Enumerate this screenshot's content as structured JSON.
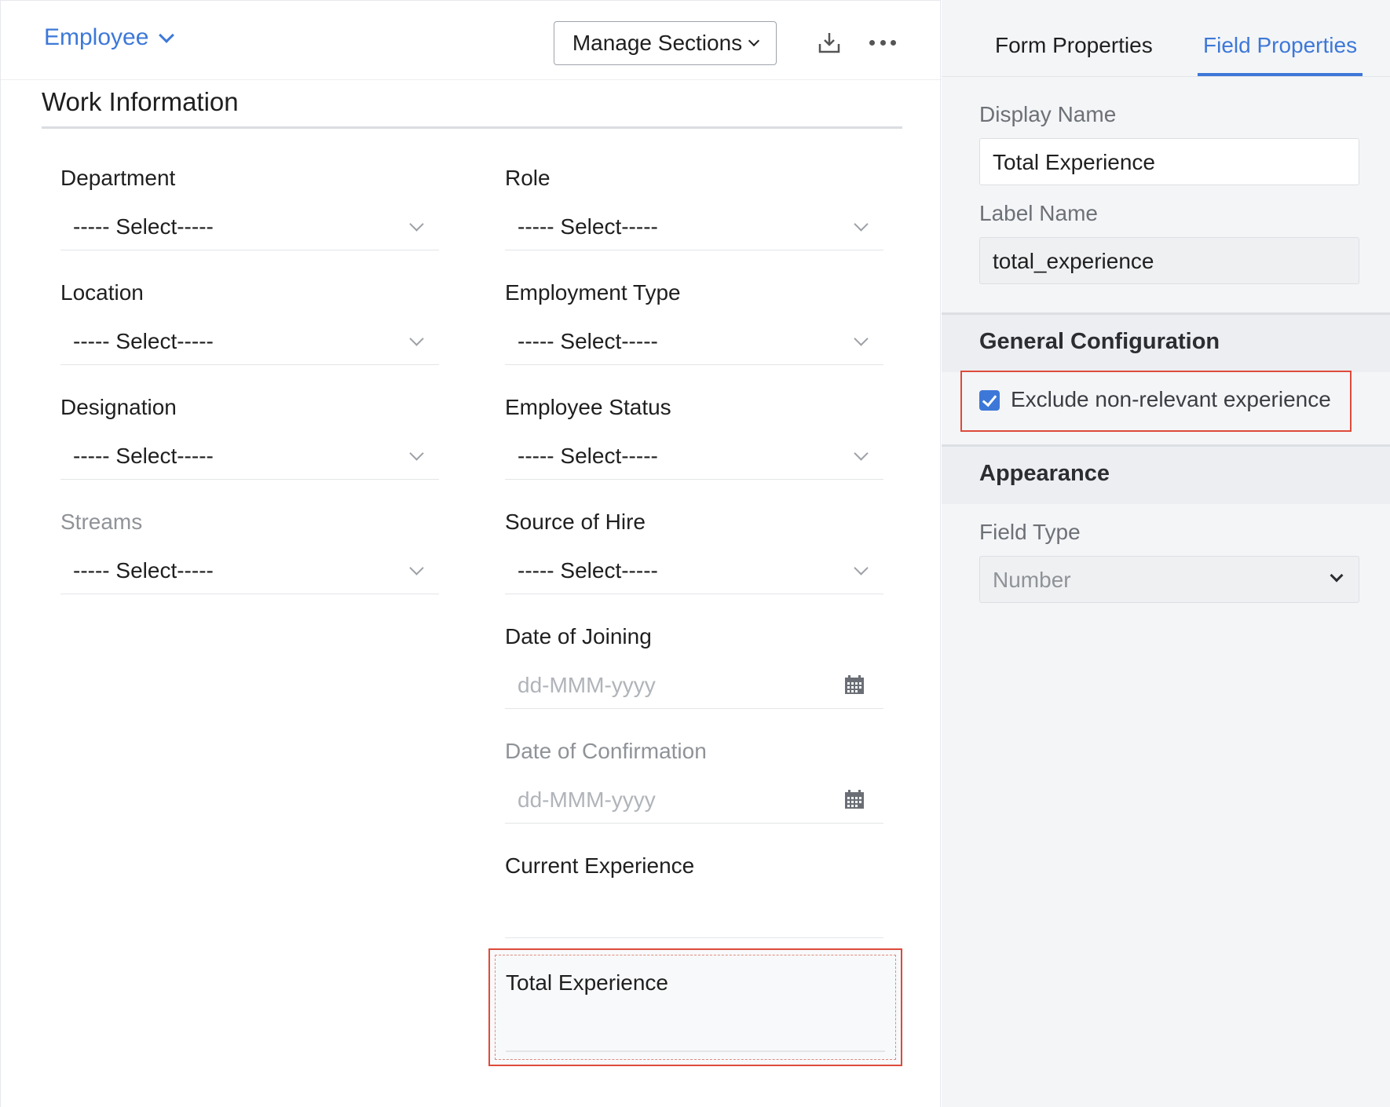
{
  "header": {
    "module_label": "Employee",
    "manage_sections_label": "Manage Sections",
    "download_icon": "download-icon",
    "more_icon": "more-horizontal-icon"
  },
  "section": {
    "title": "Work Information"
  },
  "fields": {
    "department": {
      "label": "Department",
      "value": "----- Select-----"
    },
    "role": {
      "label": "Role",
      "value": "----- Select-----"
    },
    "location": {
      "label": "Location",
      "value": "----- Select-----"
    },
    "employment_type": {
      "label": "Employment Type",
      "value": "----- Select-----"
    },
    "designation": {
      "label": "Designation",
      "value": "----- Select-----"
    },
    "employee_status": {
      "label": "Employee Status",
      "value": "----- Select-----"
    },
    "streams": {
      "label": "Streams",
      "value": "----- Select-----"
    },
    "source_of_hire": {
      "label": "Source of Hire",
      "value": "----- Select-----"
    },
    "date_of_joining": {
      "label": "Date of Joining",
      "placeholder": "dd-MMM-yyyy"
    },
    "date_of_confirmation": {
      "label": "Date of Confirmation",
      "placeholder": "dd-MMM-yyyy"
    },
    "current_experience": {
      "label": "Current Experience"
    },
    "total_experience": {
      "label": "Total Experience"
    }
  },
  "properties_panel": {
    "tabs": {
      "form_properties": "Form Properties",
      "field_properties": "Field Properties"
    },
    "active_tab": "field_properties",
    "display_name": {
      "label": "Display Name",
      "value": "Total Experience"
    },
    "label_name": {
      "label": "Label Name",
      "value": "total_experience"
    },
    "general_configuration": {
      "title": "General Configuration",
      "exclude_non_relevant": {
        "label": "Exclude non-relevant experience",
        "checked": true
      }
    },
    "appearance": {
      "title": "Appearance",
      "field_type": {
        "label": "Field Type",
        "value": "Number"
      }
    }
  },
  "colors": {
    "accent": "#3d78d8",
    "highlight": "#de4a3a"
  }
}
